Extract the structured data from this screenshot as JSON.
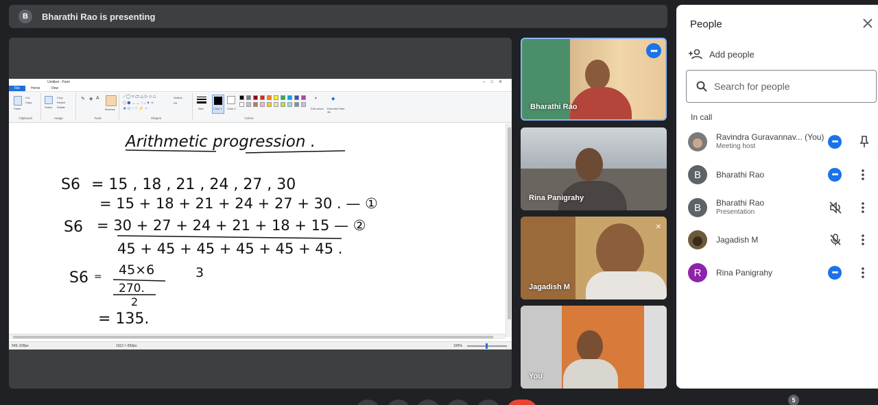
{
  "presenting": {
    "avatar_letter": "B",
    "text": "Bharathi Rao is presenting"
  },
  "paint": {
    "title": "Untitled - Paint",
    "menu": [
      "File",
      "Home",
      "View"
    ],
    "groups": [
      "Clipboard",
      "Image",
      "Tools",
      "Shapes",
      "Colors"
    ],
    "tools": {
      "paste": "Paste",
      "cut": "Cut",
      "copy": "Copy",
      "select": "Select",
      "crop": "Crop",
      "resize": "Resize",
      "rotate": "Rotate",
      "brushes": "Brushes",
      "outline": "Outline",
      "fill": "Fill",
      "size": "Size",
      "color1": "Color 1",
      "color2": "Color 2",
      "edit_colors": "Edit colors",
      "edit_with": "Edit with Paint 3D"
    },
    "palette": [
      "#000000",
      "#7f7f7f",
      "#880015",
      "#ed1c24",
      "#ff7f27",
      "#fff200",
      "#22b14c",
      "#00a2e8",
      "#3f48cc",
      "#a349a4",
      "#ffffff",
      "#c3c3c3",
      "#b97a57",
      "#ffaec9",
      "#ffc90e",
      "#efe4b0",
      "#b5e61d",
      "#99d9ea",
      "#7092be",
      "#c8bfe7"
    ],
    "status": {
      "coords": "549, 628px",
      "size": "1912 × 833px",
      "zoom": "100%"
    },
    "handwriting": {
      "title": "Arithmetic progression .",
      "line1_lhs": "S6",
      "line1": "= 15 , 18 , 21 , 24 , 27 , 30",
      "line2": "= 15 + 18 + 21 + 24 + 27 + 30 . — ①",
      "line3_lhs": "S6",
      "line3": "= 30 + 27 + 24 + 21 + 18 + 15 — ②",
      "line4": "45 + 45 + 45 + 45 + 45 + 45 .",
      "line5_lhs": "S6",
      "line5_num": "45×6",
      "line5_side": "3",
      "line5_mid": "270.",
      "line5_den": "2",
      "line6": "= 135."
    }
  },
  "tiles": [
    {
      "name": "Bharathi Rao",
      "bg": "#4a8f6a"
    },
    {
      "name": "Rina Panigrahy",
      "bg": "#6b6560"
    },
    {
      "name": "Jagadish M",
      "bg": "#c9a46a"
    },
    {
      "name": "You",
      "bg": "#d87a3a"
    }
  ],
  "people": {
    "title": "People",
    "add_label": "Add people",
    "search_placeholder": "Search for people",
    "in_call_label": "In call",
    "list": [
      {
        "name": "Ravindra Guravannav... (You)",
        "sub": "Meeting host",
        "letter": "",
        "color": "#7a7a7a"
      },
      {
        "name": "Bharathi Rao",
        "sub": "",
        "letter": "B",
        "color": "#5f6368"
      },
      {
        "name": "Bharathi Rao",
        "sub": "Presentation",
        "letter": "B",
        "color": "#5f6368"
      },
      {
        "name": "Jagadish M",
        "sub": "",
        "letter": "",
        "color": "#6b5a3a"
      },
      {
        "name": "Rina Panigrahy",
        "sub": "",
        "letter": "R",
        "color": "#8e24aa"
      }
    ]
  },
  "participant_count": "5",
  "colors": {
    "accent": "#1a73e8",
    "end_call": "#ea4335"
  }
}
